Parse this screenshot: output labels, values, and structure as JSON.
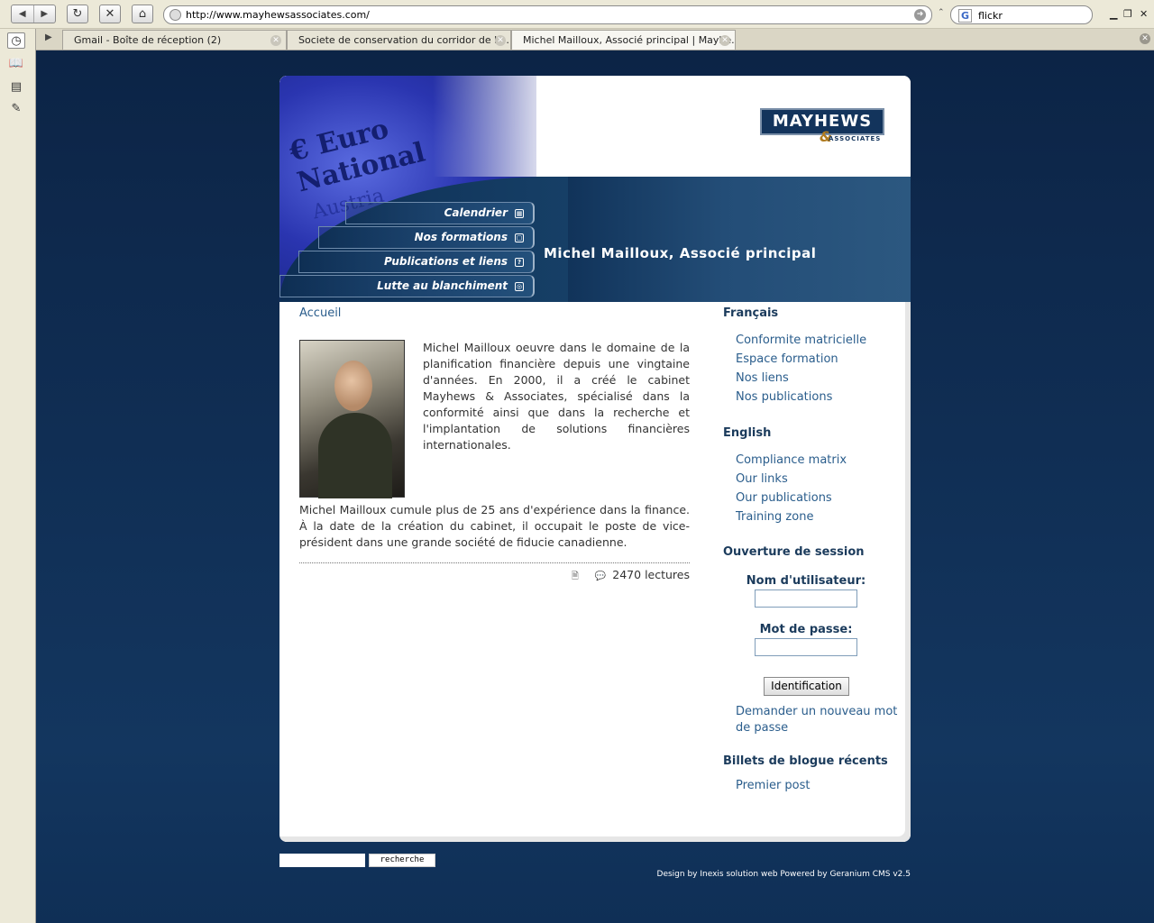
{
  "browser": {
    "url": "http://www.mayhewsassociates.com/",
    "search_query": "flickr",
    "tabs": [
      {
        "label": "Gmail - Boîte de réception (2)"
      },
      {
        "label": "Societe de conservation du corridor de la ..."
      },
      {
        "label": "Michel Mailloux, Associé principal | Mayhe..."
      }
    ]
  },
  "header": {
    "logo_text": "MAYHEWS",
    "logo_amp": "&",
    "logo_sub": "ASSOCIATES",
    "page_title": "Michel Mailloux, Associé principal",
    "hero_word1": "€ Euro",
    "hero_word2": "National",
    "hero_word3": "Austria"
  },
  "menu": [
    {
      "label": "Calendrier",
      "icon": "calendar-icon"
    },
    {
      "label": "Nos formations",
      "icon": "training-icon"
    },
    {
      "label": "Publications et liens",
      "icon": "help-icon"
    },
    {
      "label": "Lutte au blanchiment",
      "icon": "shield-icon"
    }
  ],
  "content": {
    "breadcrumb": "Accueil",
    "para1": "Michel Mailloux oeuvre dans le domaine de la planification financière depuis une vingtaine d'années. En 2000, il a créé le cabinet Mayhews & Associates, spécialisé dans la conformité ainsi que dans la recherche et l'implantation de solutions financières internationales.",
    "para2": "Michel Mailloux cumule plus de 25 ans d'expérience dans la finance. À la date de la création du cabinet, il occupait le poste de vice-président dans une grande société de fiducie canadienne.",
    "reads": "2470 lectures"
  },
  "sidebar": {
    "fr_title": "Français",
    "fr_links": [
      "Conformite matricielle",
      "Espace formation",
      "Nos liens",
      "Nos publications"
    ],
    "en_title": "English",
    "en_links": [
      "Compliance matrix",
      "Our links",
      "Our publications",
      "Training zone"
    ],
    "login_title": "Ouverture de session",
    "username_label": "Nom d'utilisateur:",
    "password_label": "Mot de passe:",
    "login_button": "Identification",
    "forgot_line1": "Demander un nouveau mot",
    "forgot_line2": "de passe",
    "blog_title": "Billets de blogue récents",
    "blog_links": [
      "Premier post"
    ]
  },
  "footer": {
    "search_button": "recherche",
    "credits": "Design by Inexis solution web Powered by Geranium CMS v2.5"
  }
}
